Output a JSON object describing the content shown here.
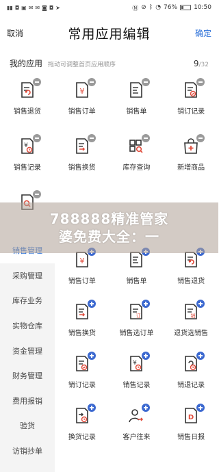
{
  "status": {
    "left_icons": [
      "signal",
      "bag",
      "image",
      "mail",
      "mail",
      "message",
      "bag",
      "nav"
    ],
    "right_icons": [
      "nfc",
      "mute",
      "bluetooth",
      "wifi"
    ],
    "battery": "76%",
    "time": "10:50"
  },
  "nav": {
    "cancel": "取消",
    "title": "常用应用编辑",
    "done": "确定"
  },
  "my_apps": {
    "title": "我的应用",
    "hint": "拖动可调整首页应用顺序",
    "count": "9",
    "total": "/32",
    "items": [
      {
        "label": "销售退货",
        "icon": "doc-return-icon"
      },
      {
        "label": "销售订单",
        "icon": "doc-yen-icon"
      },
      {
        "label": "销售单",
        "icon": "doc-lines-icon"
      },
      {
        "label": "销订记录",
        "icon": "doc-check-icon"
      },
      {
        "label": "销售记录",
        "icon": "doc-yen-clock-icon"
      },
      {
        "label": "销售换货",
        "icon": "doc-exchange-icon"
      },
      {
        "label": "库存查询",
        "icon": "box-search-icon"
      },
      {
        "label": "新增商品",
        "icon": "bag-plus-icon"
      },
      {
        "label": "",
        "icon": "doc-search-icon"
      }
    ]
  },
  "sidebar": {
    "items": [
      "销售管理",
      "采购管理",
      "库存业务",
      "实物仓库",
      "资金管理",
      "财务管理",
      "费用报销",
      "验货",
      "访销抄单"
    ]
  },
  "category_apps": {
    "items": [
      {
        "label": "销售订单",
        "icon": "doc-yen-icon"
      },
      {
        "label": "销售单",
        "icon": "doc-lines-icon"
      },
      {
        "label": "销售退货",
        "icon": "doc-return-icon"
      },
      {
        "label": "销售换货",
        "icon": "doc-exchange-icon"
      },
      {
        "label": "销售选订单",
        "icon": "doc-order-icon"
      },
      {
        "label": "退货选销售",
        "icon": "doc-sale-icon"
      },
      {
        "label": "销订记录",
        "icon": "doc-check-icon"
      },
      {
        "label": "销售记录",
        "icon": "doc-yen-clock-icon"
      },
      {
        "label": "销退记录",
        "icon": "doc-return-clock-icon"
      },
      {
        "label": "换货记录",
        "icon": "doc-exchange-clock-icon"
      },
      {
        "label": "客户往来",
        "icon": "person-exchange-icon"
      },
      {
        "label": "销售日报",
        "icon": "doc-d-icon"
      }
    ]
  },
  "watermark": {
    "line1": "788888精准管家",
    "line2": "婆免费大全：一"
  },
  "colors": {
    "accent": "#2a6fd8",
    "badge_remove": "#9a9a9a",
    "badge_add": "#3c69d0",
    "icon_red": "#e04a3a",
    "icon_stroke": "#333333"
  }
}
